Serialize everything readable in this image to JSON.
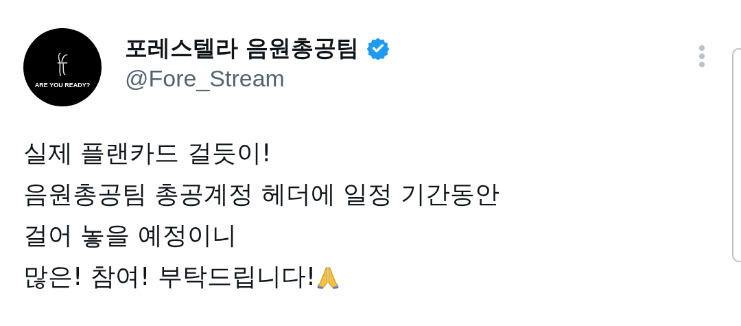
{
  "author": {
    "name": "포레스텔라 음원총공팀",
    "verified": true,
    "handle": "@Fore_Stream",
    "avatar_caption": "ARE YOU READY?"
  },
  "tweet": {
    "lines": [
      "실제 플랜카드 걸듯이!",
      "음원총공팀 총공계정 헤더에 일정 기간동안",
      "걸어 놓을 예정이니",
      "많은! 참여! 부탁드립니다!"
    ]
  }
}
